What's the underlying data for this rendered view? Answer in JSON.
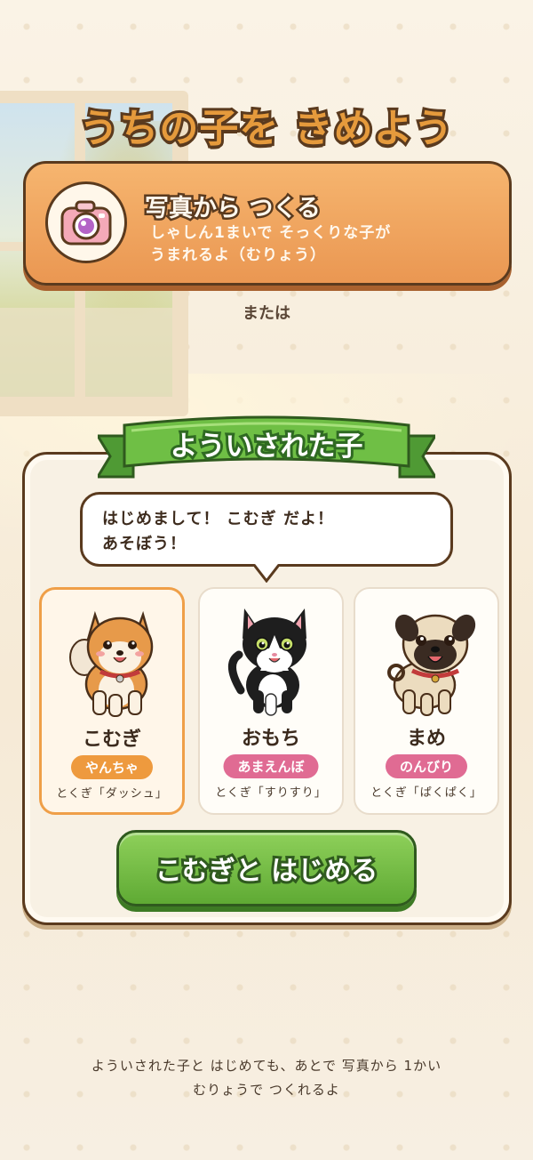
{
  "header": {
    "title": "うちの子を きめよう"
  },
  "photo_option": {
    "title": "写真から つくる",
    "subtitle_line1": "しゃしん1まいで そっくりな子が",
    "subtitle_line2": "うまれるよ（むりょう）",
    "icon": "camera-icon"
  },
  "divider_text": "または",
  "presets": {
    "ribbon_title": "ようい​された子",
    "speech_line1": "はじめまして！ こむぎ だよ！",
    "speech_line2": "あそぼう！",
    "pets": [
      {
        "name": "こむぎ",
        "badge": "やんちゃ",
        "skill": "とくぎ「ダッシュ」",
        "icon": "shiba-dog-icon",
        "badge_color": "#ee9a3e",
        "selected": true
      },
      {
        "name": "おもち",
        "badge": "あまえんぼ",
        "skill": "とくぎ「すりすり」",
        "icon": "tuxedo-cat-icon",
        "badge_color": "#e06b93",
        "selected": false
      },
      {
        "name": "まめ",
        "badge": "のんびり",
        "skill": "とくぎ「ぱくぱく」",
        "icon": "pug-dog-icon",
        "badge_color": "#e06b93",
        "selected": false
      }
    ],
    "start_button": "こむぎと はじめる"
  },
  "footer": {
    "line1": "よういされた子と はじめても、あとで 写真から 1かい",
    "line2": "むりょうで つくれるよ"
  },
  "colors": {
    "accent_orange": "#ee9a3e",
    "accent_green": "#5faa34",
    "accent_pink": "#e06b93",
    "outline_brown": "#5a3a1e"
  }
}
